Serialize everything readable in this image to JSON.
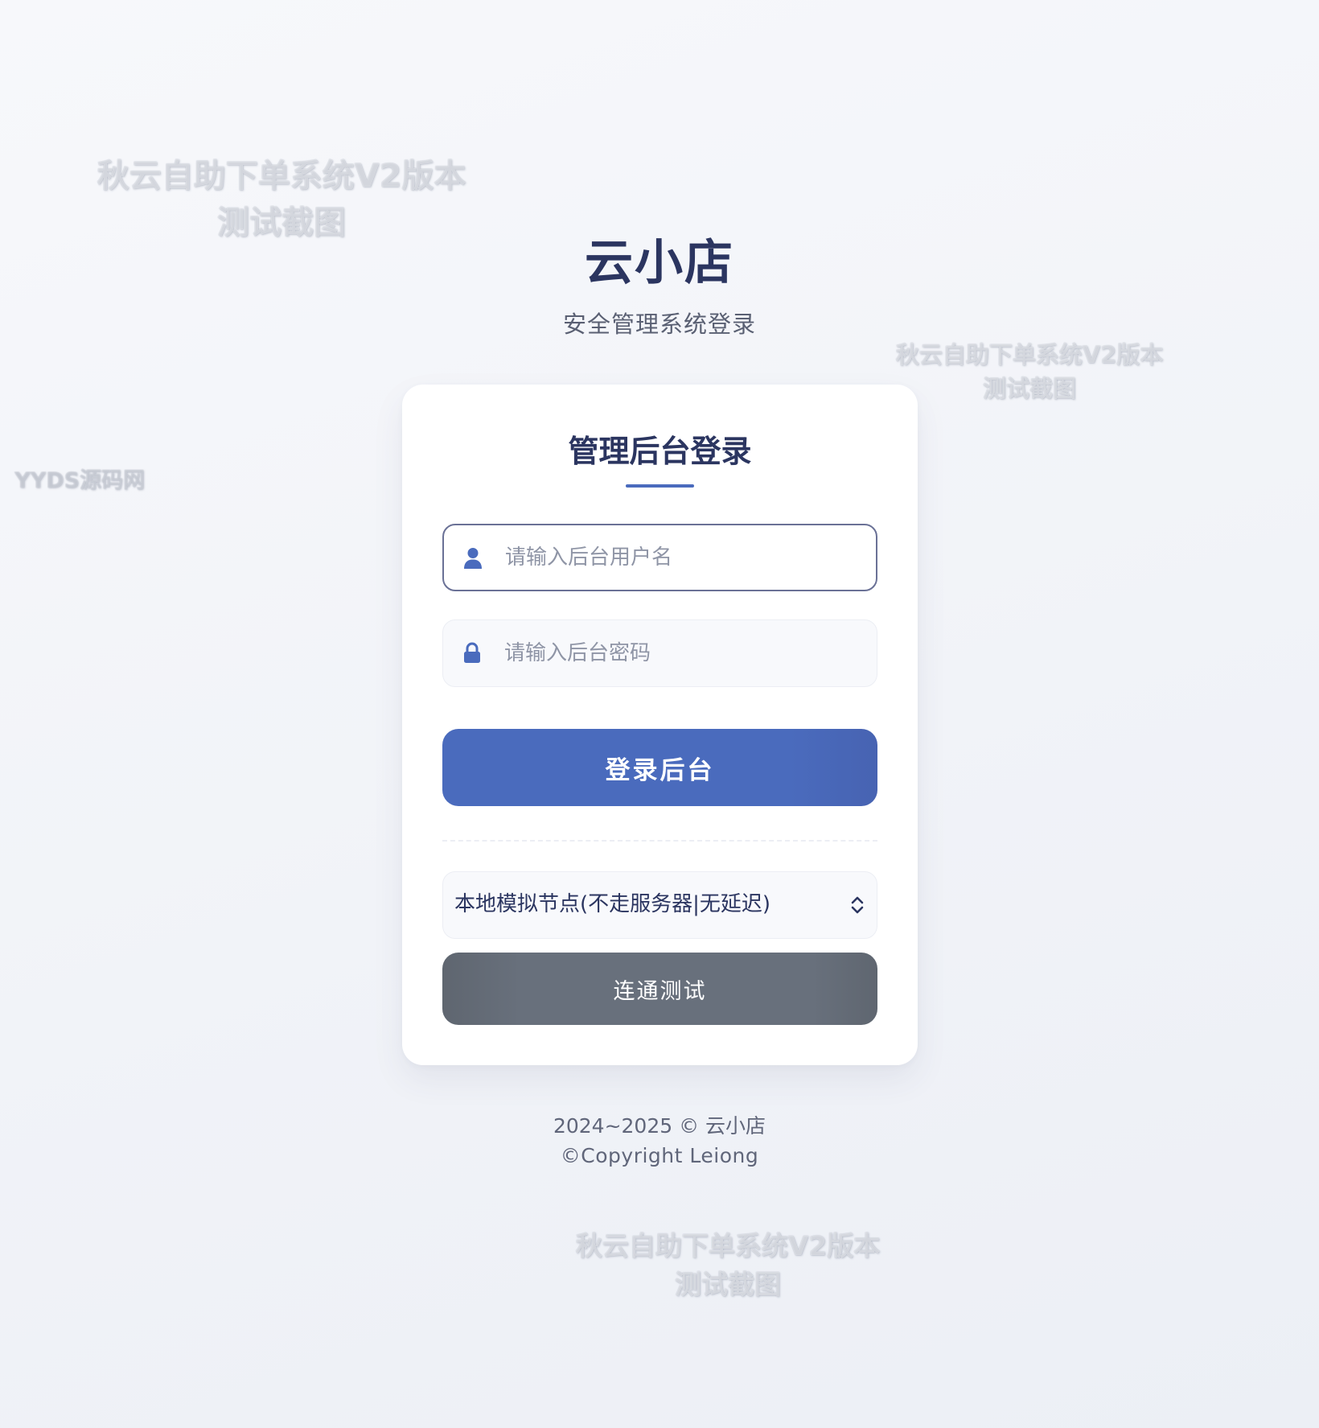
{
  "header": {
    "brand": "云小店",
    "subtitle": "安全管理系统登录"
  },
  "card": {
    "title": "管理后台登录",
    "username": {
      "placeholder": "请输入后台用户名",
      "value": "",
      "icon": "user-icon"
    },
    "password": {
      "placeholder": "请输入后台密码",
      "value": "",
      "icon": "lock-icon"
    },
    "login_button": "登录后台",
    "node_select": {
      "selected": "本地模拟节点(不走服务器|无延迟)",
      "icon": "chevron-up-down-icon"
    },
    "test_button": "连通测试"
  },
  "footer": {
    "line1": "2024~2025 © 云小店",
    "line2": "©Copyright Leiong"
  },
  "watermarks": {
    "wm1": [
      "秋云自助下单系统V2版本",
      "测试截图"
    ],
    "wm2": [
      "秋云自助下单系统V2版本",
      "测试截图"
    ],
    "wm3": [
      "秋云自助下单系统V2版本",
      "测试截图"
    ],
    "wm4": "YYDS源码网"
  },
  "colors": {
    "primary": "#4a6bbd",
    "heading": "#2b3560",
    "secondary_button": "#68707c",
    "background": "#f1f3f8"
  }
}
